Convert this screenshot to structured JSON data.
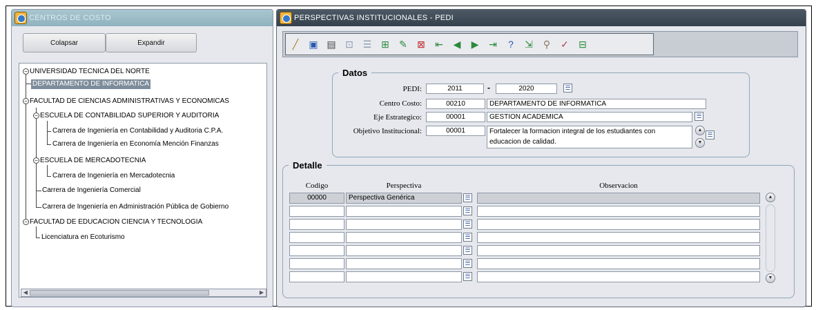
{
  "left_window": {
    "title": "CENTROS DE COSTO",
    "collapse_label": "Colapsar",
    "expand_label": "Expandir",
    "tree": [
      {
        "label": "UNIVERSIDAD TECNICA DEL NORTE",
        "toggle": "−"
      },
      {
        "label": "DEPARTAMENTO DE INFORMATICA"
      },
      {
        "label": "FACULTAD DE CIENCIAS ADMINISTRATIVAS Y ECONOMICAS",
        "toggle": "−"
      },
      {
        "label": "ESCUELA DE CONTABILIDAD SUPERIOR Y AUDITORIA",
        "toggle": "−"
      },
      {
        "label": "Carrera de Ingeniería en Contabilidad y Auditoria C.P.A."
      },
      {
        "label": "Carrera de Ingeniería en Economía Mención Finanzas"
      },
      {
        "label": "ESCUELA DE MERCADOTECNIA",
        "toggle": "−"
      },
      {
        "label": "Carrera de Ingeniería en Mercadotecnia"
      },
      {
        "label": "Carrera de Ingeniería Comercial"
      },
      {
        "label": "Carrera de Ingeniería en Administración Pública de Gobierno"
      },
      {
        "label": "FACULTAD DE EDUCACION CIENCIA Y TECNOLOGIA",
        "toggle": "−"
      },
      {
        "label": "Licenciatura en Ecoturismo"
      }
    ]
  },
  "right_window": {
    "title": "PERSPECTIVAS INSTITUCIONALES - PEDI",
    "toolbar_icons": [
      "clear-icon",
      "save-icon",
      "print-icon",
      "query-icon",
      "list-icon",
      "insert-record-icon",
      "edit-record-icon",
      "delete-record-icon",
      "first-record-icon",
      "previous-record-icon",
      "next-record-icon",
      "last-record-icon",
      "help-icon",
      "exit-icon",
      "tool-icon",
      "edit-note-icon",
      "window-icon"
    ],
    "datos": {
      "legend": "Datos",
      "pedi_label": "PEDI:",
      "pedi_from": "2011",
      "pedi_dash": "-",
      "pedi_to": "2020",
      "centro_label": "Centro Costo:",
      "centro_code": "00210",
      "centro_name": "DEPARTAMENTO DE INFORMATICA",
      "eje_label": "Eje Estrategico:",
      "eje_code": "00001",
      "eje_name": "GESTION ACADEMICA",
      "objetivo_label": "Objetivo Institucional:",
      "objetivo_code": "00001",
      "objetivo_text_line1": "Fortalecer la formacion integral de los estudiantes con",
      "objetivo_text_line2": "educacion de calidad."
    },
    "detalle": {
      "legend": "Detalle",
      "col_codigo": "Codigo",
      "col_perspectiva": "Perspectiva",
      "col_observacion": "Observacion",
      "rows": [
        {
          "codigo": "00000",
          "perspectiva": "Perspectiva Genérica",
          "observacion": ""
        },
        {
          "codigo": "",
          "perspectiva": "",
          "observacion": ""
        },
        {
          "codigo": "",
          "perspectiva": "",
          "observacion": ""
        },
        {
          "codigo": "",
          "perspectiva": "",
          "observacion": ""
        },
        {
          "codigo": "",
          "perspectiva": "",
          "observacion": ""
        },
        {
          "codigo": "",
          "perspectiva": "",
          "observacion": ""
        },
        {
          "codigo": "",
          "perspectiva": "",
          "observacion": ""
        }
      ]
    }
  }
}
